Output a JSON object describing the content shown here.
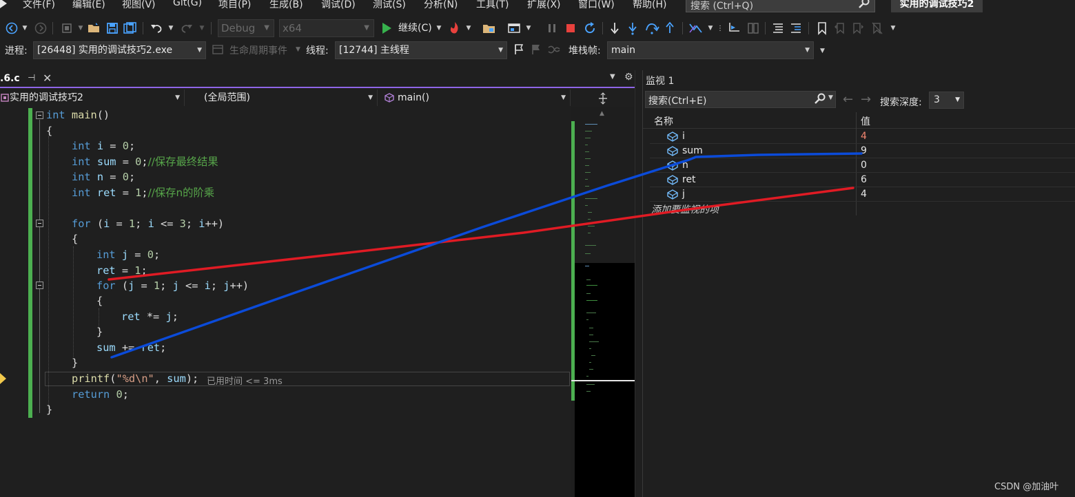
{
  "menu": [
    "文件(F)",
    "编辑(E)",
    "视图(V)",
    "Git(G)",
    "项目(P)",
    "生成(B)",
    "调试(D)",
    "测试(S)",
    "分析(N)",
    "工具(T)",
    "扩展(X)",
    "窗口(W)",
    "帮助(H)"
  ],
  "search": {
    "placeholder": "搜索 (Ctrl+Q)"
  },
  "app_title": "实用的调试技巧2",
  "toolbar": {
    "config": "Debug",
    "platform": "x64",
    "continue_label": "继续(C)"
  },
  "process_bar": {
    "process_label": "进程:",
    "process_value": "[26448] 实用的调试技巧2.exe",
    "lifecycle_label": "生命周期事件",
    "thread_label": "线程:",
    "thread_value": "[12744] 主线程",
    "stack_label": "堆栈帧:",
    "stack_value": "main"
  },
  "editor": {
    "tab_name": ".6.c",
    "nav_project": "实用的调试技巧2",
    "nav_scope": "(全局范围)",
    "nav_function": "main()",
    "elapsed_hint": "已用时间 <= 3ms"
  },
  "watch": {
    "title": "监视 1",
    "search_placeholder": "搜索(Ctrl+E)",
    "depth_label": "搜索深度:",
    "depth_value": "3",
    "col_name": "名称",
    "col_value": "值",
    "rows": [
      {
        "name": "i",
        "value": "4",
        "changed": true
      },
      {
        "name": "sum",
        "value": "9",
        "changed": false
      },
      {
        "name": "n",
        "value": "0",
        "changed": false
      },
      {
        "name": "ret",
        "value": "6",
        "changed": false
      },
      {
        "name": "j",
        "value": "4",
        "changed": false
      }
    ],
    "add_item": "添加要监视的项"
  },
  "watermark": "CSDN @加油叶",
  "colors": {
    "accent": "#8f65e8",
    "annotation_red": "#e01b24",
    "annotation_blue": "#0b4bd9",
    "changed_value": "#f48771"
  }
}
